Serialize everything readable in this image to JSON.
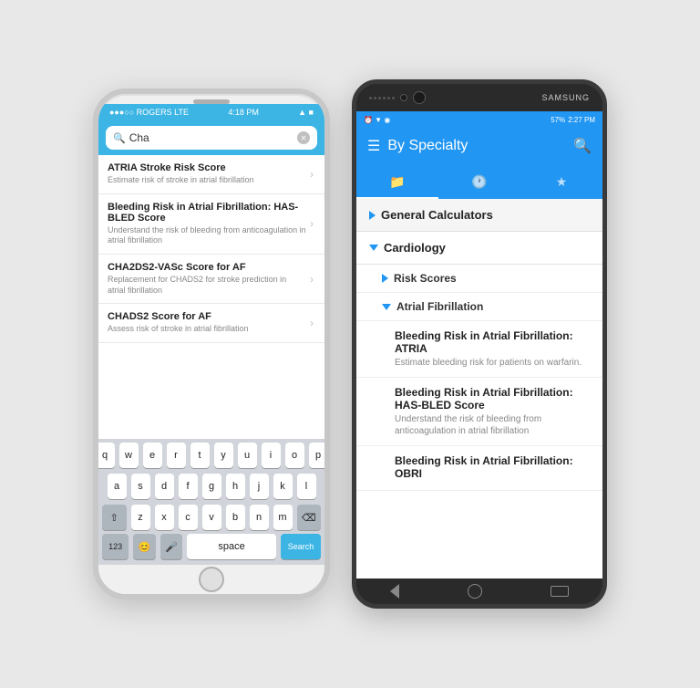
{
  "iphone": {
    "status_bar": {
      "carrier": "●●●○○ ROGERS LTE",
      "time": "4:18 PM",
      "icons": "▲ ■"
    },
    "search_bar": {
      "placeholder": "Cha",
      "icon": "🔍"
    },
    "results": [
      {
        "title": "ATRIA Stroke Risk Score",
        "desc": "Estimate risk of stroke in atrial fibrillation"
      },
      {
        "title": "Bleeding Risk in Atrial Fibrillation: HAS-BLED Score",
        "desc": "Understand the risk of bleeding from anticoagulation in atrial fibrillation"
      },
      {
        "title": "CHA2DS2-VASc Score for AF",
        "desc": "Replacement for CHADS2 for stroke prediction in atrial fibrillation"
      },
      {
        "title": "CHADS2 Score for AF",
        "desc": "Assess risk of stroke in atrial fibrillation"
      }
    ],
    "keyboard": {
      "rows": [
        [
          "q",
          "w",
          "e",
          "r",
          "t",
          "y",
          "u",
          "i",
          "o",
          "p"
        ],
        [
          "a",
          "s",
          "d",
          "f",
          "g",
          "h",
          "j",
          "k",
          "l"
        ],
        [
          "⇧",
          "z",
          "x",
          "c",
          "v",
          "b",
          "n",
          "m",
          "⌫"
        ],
        [
          "123",
          "😊",
          "🎤",
          "space",
          "Search"
        ]
      ]
    }
  },
  "samsung": {
    "status_bar": {
      "left_icons": "⏰ ▼ ◉",
      "battery": "57%",
      "time": "2:27 PM"
    },
    "header": {
      "menu_icon": "☰",
      "title": "By Specialty",
      "search_icon": "🔍"
    },
    "tabs": [
      {
        "label": "📁",
        "active": true
      },
      {
        "label": "🕐",
        "active": false
      },
      {
        "label": "★",
        "active": false
      }
    ],
    "sections": [
      {
        "title": "General Calculators",
        "expanded": false,
        "items": []
      },
      {
        "title": "Cardiology",
        "expanded": true,
        "subsections": [
          {
            "title": "Risk Scores",
            "expanded": false,
            "items": []
          },
          {
            "title": "Atrial Fibrillation",
            "expanded": true,
            "items": [
              {
                "title": "Bleeding Risk in Atrial Fibrillation: ATRIA",
                "desc": "Estimate bleeding risk for patients on warfarin."
              },
              {
                "title": "Bleeding Risk in Atrial Fibrillation: HAS-BLED Score",
                "desc": "Understand the risk of bleeding from anticoagulation in atrial fibrillation"
              },
              {
                "title": "Bleeding Risk in Atrial Fibrillation: OBRI",
                "desc": ""
              }
            ]
          }
        ]
      }
    ]
  }
}
